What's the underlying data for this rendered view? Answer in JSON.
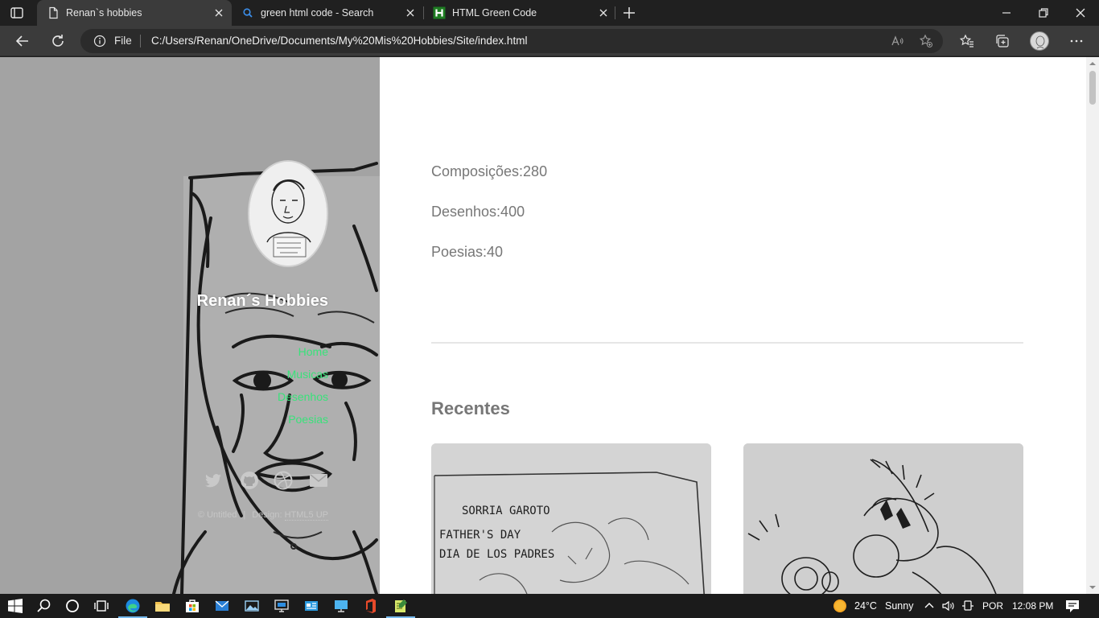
{
  "browser": {
    "tabs": [
      {
        "title": "Renan`s hobbies",
        "icon": "page-icon",
        "active": true
      },
      {
        "title": "green html code - Search",
        "icon": "search-icon",
        "active": false
      },
      {
        "title": "HTML Green Code",
        "icon": "h-logo-icon",
        "active": false
      }
    ],
    "address": {
      "scheme_label": "File",
      "url": "C:/Users/Renan/OneDrive/Documents/My%20Mis%20Hobbies/Site/index.html"
    }
  },
  "sidebar": {
    "title": "Renan´s Hobbies",
    "nav": [
      {
        "label": "Home"
      },
      {
        "label": "Musicas"
      },
      {
        "label": "Desenhos"
      },
      {
        "label": "Poesias"
      }
    ],
    "social_icons": [
      "twitter-icon",
      "github-icon",
      "dribbble-icon",
      "email-icon"
    ],
    "copyright": {
      "left": "© Untitled",
      "separator": "|",
      "design_label": "Design:",
      "design_link": "HTML5 UP"
    },
    "link_color": "#39e27a"
  },
  "main": {
    "stats": [
      {
        "text": "Composições:280"
      },
      {
        "text": "Desenhos:400"
      },
      {
        "text": "Poesias:40"
      }
    ],
    "recent_title": "Recentes",
    "card_sketch_text": [
      "SORRIA  GAROTO",
      "FATHER'S  DAY",
      "DIA DE LOS PADRES"
    ]
  },
  "taskbar": {
    "weather": {
      "temp": "24°C",
      "condition": "Sunny"
    },
    "language": "POR",
    "time": "12:08 PM"
  },
  "colors": {
    "tab_strip": "#202020",
    "toolbar": "#3b3b3b",
    "body_text": "#777777",
    "accent_green": "#39e27a"
  }
}
